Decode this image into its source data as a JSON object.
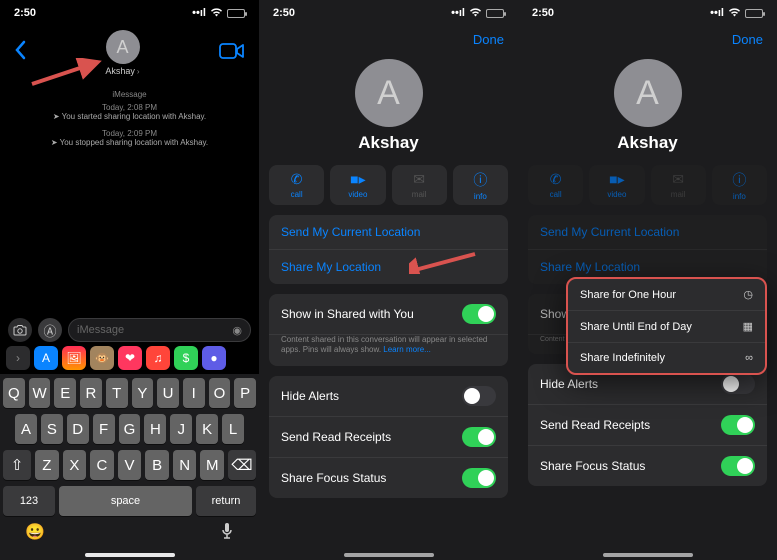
{
  "status": {
    "time": "2:50"
  },
  "phone1": {
    "contact_initial": "A",
    "contact_name": "Akshay",
    "input_placeholder": "iMessage",
    "system_label": "iMessage",
    "t1": "Today, 2:08 PM",
    "m1": "You started sharing location with Akshay.",
    "t2": "Today, 2:09 PM",
    "m2": "You stopped sharing location with Akshay.",
    "keys_row1": [
      "Q",
      "W",
      "E",
      "R",
      "T",
      "Y",
      "U",
      "I",
      "O",
      "P"
    ],
    "keys_row2": [
      "A",
      "S",
      "D",
      "F",
      "G",
      "H",
      "J",
      "K",
      "L"
    ],
    "keys_row3": [
      "Z",
      "X",
      "C",
      "V",
      "B",
      "N",
      "M"
    ],
    "k123": "123",
    "kspace": "space",
    "kreturn": "return"
  },
  "detail": {
    "done": "Done",
    "name": "Akshay",
    "initial": "A",
    "actions": {
      "call": "call",
      "video": "video",
      "mail": "mail",
      "info": "info"
    },
    "send_current": "Send My Current Location",
    "share_loc": "Share My Location",
    "shared_with_you": "Show in Shared with You",
    "footnote_a": "Content shared in this conversation will appear in selected apps. Pins will always show. ",
    "footnote_link": "Learn more...",
    "hide_alerts": "Hide Alerts",
    "read_receipts": "Send Read Receipts",
    "focus_status": "Share Focus Status",
    "show_partial": "Show"
  },
  "popup": {
    "one_hour": "Share for One Hour",
    "eod": "Share Until End of Day",
    "indef": "Share Indefinitely"
  }
}
